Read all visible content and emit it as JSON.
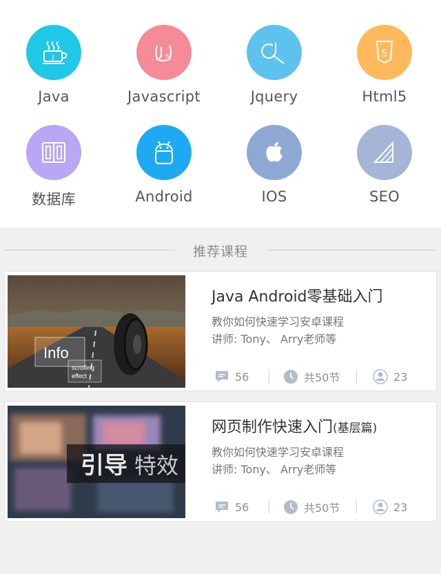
{
  "categories": [
    {
      "label": "Java",
      "icon": "coffee-cup-icon",
      "color": "#1ec8e6"
    },
    {
      "label": "Javascript",
      "icon": "js-icon",
      "color": "#f68b98"
    },
    {
      "label": "Jquery",
      "icon": "jquery-icon",
      "color": "#5ec2ee"
    },
    {
      "label": "Html5",
      "icon": "html5-shield-icon",
      "color": "#ffb95a"
    },
    {
      "label": "数据库",
      "icon": "database-icon",
      "color": "#b9a6f5"
    },
    {
      "label": "Android",
      "icon": "android-icon",
      "color": "#1eaaf2"
    },
    {
      "label": "IOS",
      "icon": "apple-icon",
      "color": "#8ea8d4"
    },
    {
      "label": "SEO",
      "icon": "seo-chart-icon",
      "color": "#a5b5d8"
    }
  ],
  "section": {
    "title": "推荐课程"
  },
  "courses": [
    {
      "title": "Java Android零基础入门",
      "title_suffix": "",
      "desc": "教你如何快速学习安卓课程",
      "teacher": "讲师:  Tony、 Arry老师等",
      "thumb_text": "Info",
      "thumb_sub1": "scrolling",
      "thumb_sub2": "effect",
      "comments": "56",
      "lessons": "共50节",
      "students": "23"
    },
    {
      "title": "网页制作快速入门",
      "title_suffix": "(基层篇)",
      "desc": "教你如何快速学习安卓课程",
      "teacher": "讲师:  Tony、 Arry老师等",
      "thumb_text1": "引导",
      "thumb_text2": "特效",
      "comments": "56",
      "lessons": "共50节",
      "students": "23"
    }
  ],
  "colors": {
    "stat_icon": "#b3bccb"
  }
}
